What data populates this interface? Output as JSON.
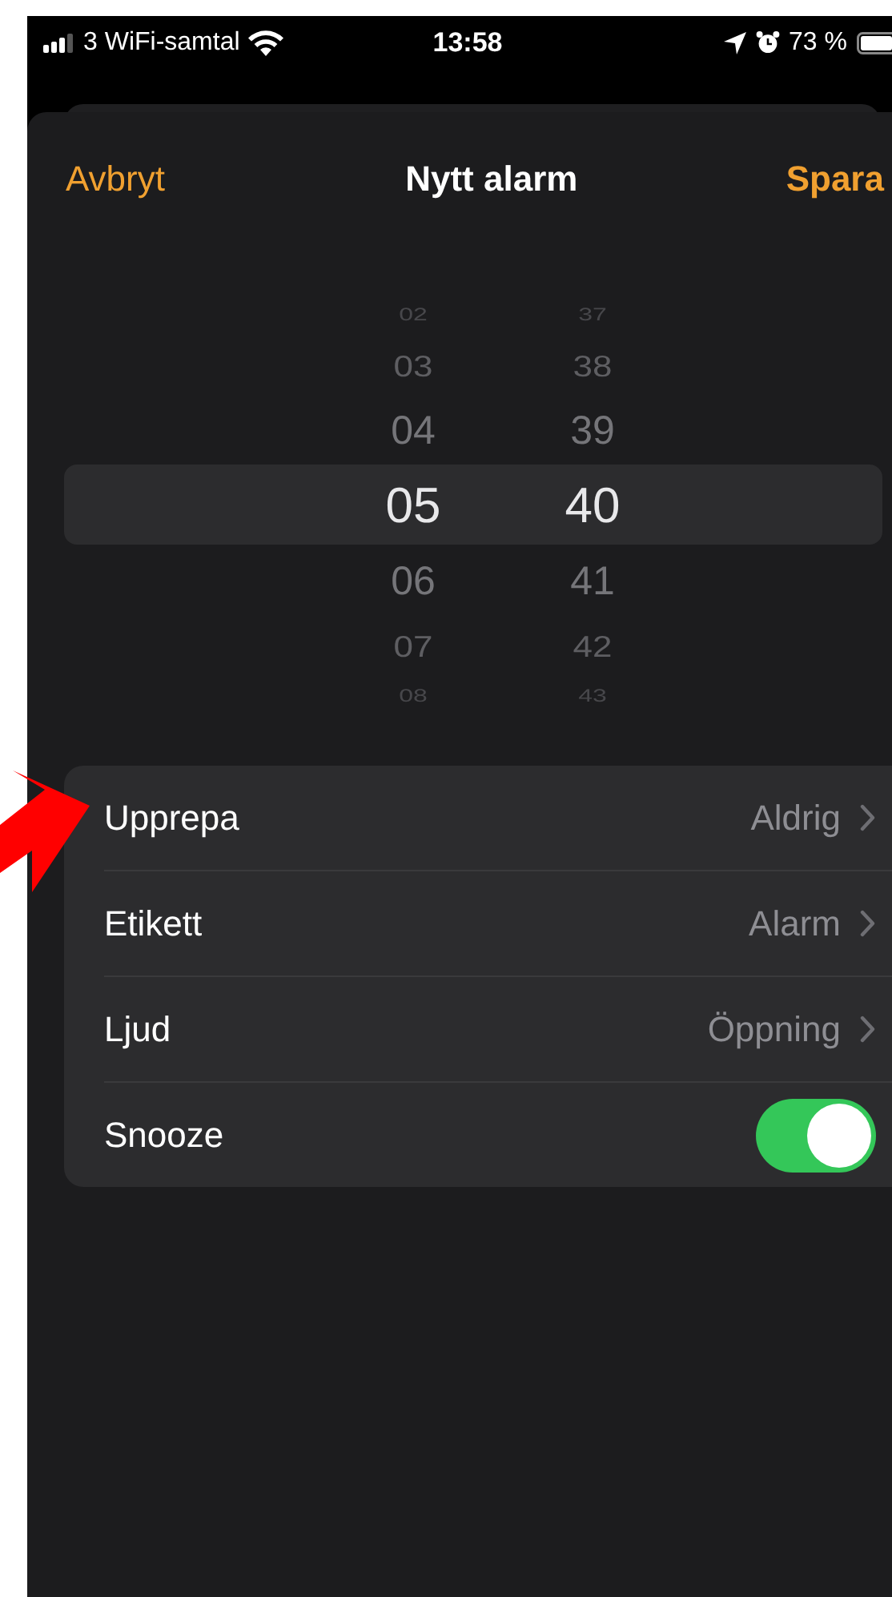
{
  "status_bar": {
    "carrier": "3 WiFi-samtal",
    "time": "13:58",
    "battery": "73 %"
  },
  "nav": {
    "cancel": "Avbryt",
    "title": "Nytt alarm",
    "save": "Spara"
  },
  "picker": {
    "hours": [
      {
        "label": "02",
        "selected": false
      },
      {
        "label": "03",
        "selected": false
      },
      {
        "label": "04",
        "selected": false
      },
      {
        "label": "05",
        "selected": true
      },
      {
        "label": "06",
        "selected": false
      },
      {
        "label": "07",
        "selected": false
      },
      {
        "label": "08",
        "selected": false
      }
    ],
    "minutes": [
      {
        "label": "37",
        "selected": false
      },
      {
        "label": "38",
        "selected": false
      },
      {
        "label": "39",
        "selected": false
      },
      {
        "label": "40",
        "selected": true
      },
      {
        "label": "41",
        "selected": false
      },
      {
        "label": "42",
        "selected": false
      },
      {
        "label": "43",
        "selected": false
      }
    ]
  },
  "settings": [
    {
      "kind": "value",
      "label": "Upprepa",
      "value": "Aldrig"
    },
    {
      "kind": "value",
      "label": "Etikett",
      "value": "Alarm"
    },
    {
      "kind": "value",
      "label": "Ljud",
      "value": "Öppning"
    },
    {
      "kind": "toggle",
      "label": "Snooze",
      "on": true
    }
  ]
}
